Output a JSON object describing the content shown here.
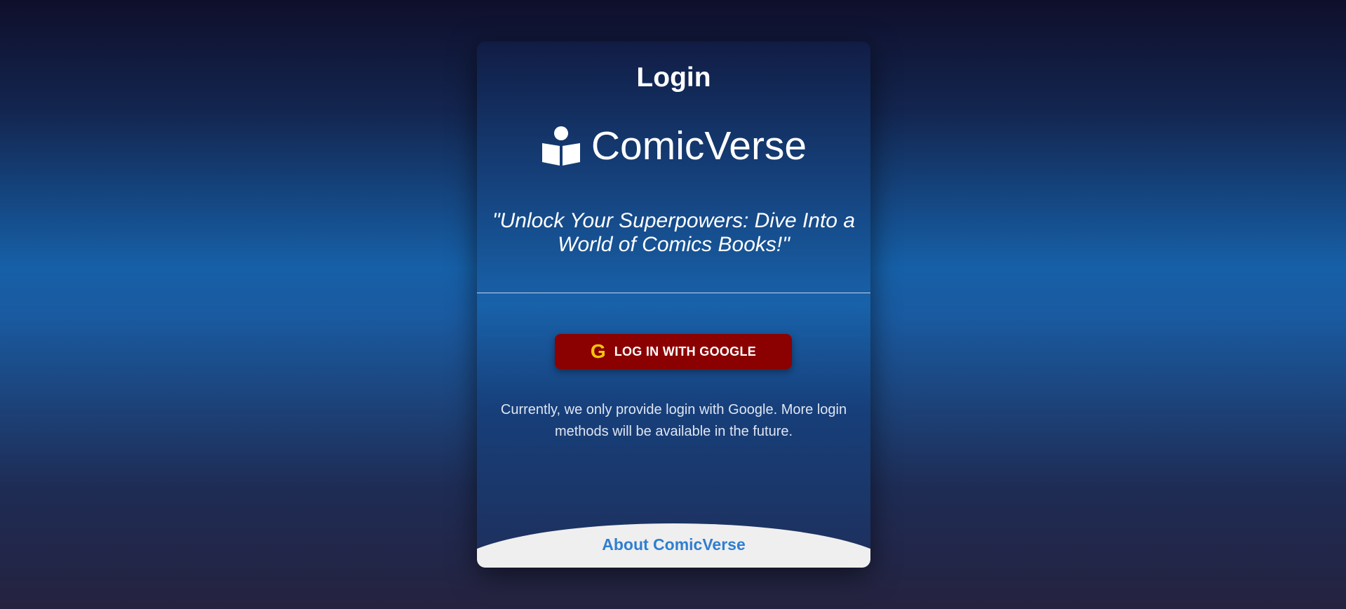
{
  "login": {
    "title": "Login",
    "brand": {
      "name": "ComicVerse",
      "icon": "reader-book-icon"
    },
    "tagline": "\"Unlock Your Superpowers: Dive Into a World of Comics Books!\"",
    "google_button": {
      "icon": "google-g-icon",
      "icon_glyph": "G",
      "label": "LOG IN WITH GOOGLE"
    },
    "info_text": "Currently, we only provide login with Google. More login methods will be available in the future.",
    "about_link": "About ComicVerse"
  },
  "colors": {
    "button_bg": "#8b0000",
    "link": "#2f7fd1",
    "footer_bg": "#efefef"
  }
}
